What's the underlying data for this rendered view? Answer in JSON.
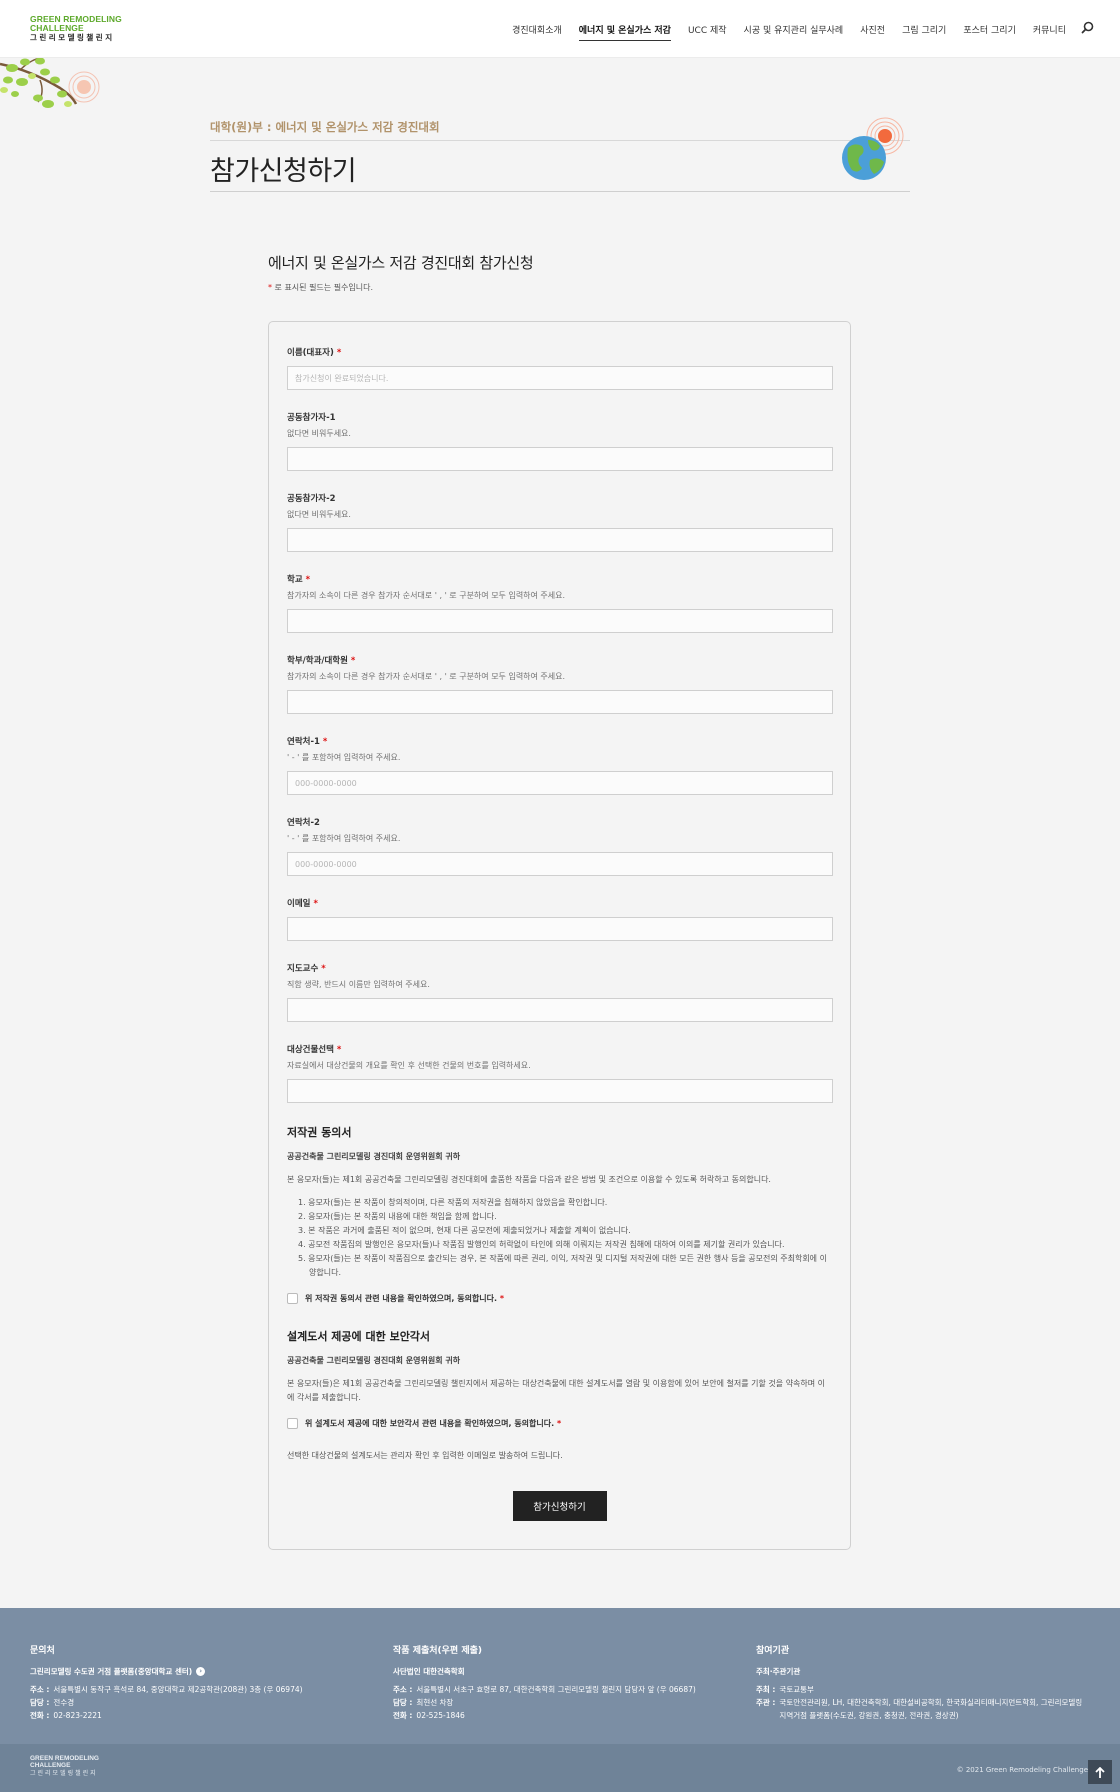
{
  "header": {
    "logo_en_1": "GREEN REMODELING",
    "logo_en_2": "CHALLENGE",
    "logo_ko": "그린리모델링챌린지",
    "nav": [
      {
        "label": "경진대회소개",
        "active": false
      },
      {
        "label": "에너지 및 온실가스 저감",
        "active": true
      },
      {
        "label": "UCC 제작",
        "active": false
      },
      {
        "label": "시공 및 유지관리 실무사례",
        "active": false
      },
      {
        "label": "사진전",
        "active": false
      },
      {
        "label": "그림 그리기",
        "active": false
      },
      {
        "label": "포스터 그리기",
        "active": false
      },
      {
        "label": "커뮤니티",
        "active": false
      }
    ]
  },
  "page": {
    "subtitle": "대학(원)부 : 에너지 및 온실가스 저감 경진대회",
    "title": "참가신청하기"
  },
  "form": {
    "heading": "에너지 및 온실가스 저감 경진대회 참가신청",
    "required_mark": "*",
    "required_note": " 로 표시된 필드는 필수입니다.",
    "fields": [
      {
        "label": "이름(대표자)",
        "required": true,
        "hint": "",
        "placeholder": "참가신청이 완료되었습니다."
      },
      {
        "label": "공동참가자-1",
        "required": false,
        "hint": "없다면 비워두세요.",
        "placeholder": ""
      },
      {
        "label": "공동참가자-2",
        "required": false,
        "hint": "없다면 비워두세요.",
        "placeholder": ""
      },
      {
        "label": "학교",
        "required": true,
        "hint": "참가자의 소속이 다른 경우 참가자 순서대로 ' , ' 로 구분하여 모두 입력하여 주세요.",
        "placeholder": ""
      },
      {
        "label": "학부/학과/대학원",
        "required": true,
        "hint": "참가자의 소속이 다른 경우 참가자 순서대로 ' , ' 로 구분하여 모두 입력하여 주세요.",
        "placeholder": ""
      },
      {
        "label": "연락처-1",
        "required": true,
        "hint": "' - ' 를 포함하여 입력하여 주세요.",
        "placeholder": "000-0000-0000"
      },
      {
        "label": "연락처-2",
        "required": false,
        "hint": "' - ' 를 포함하여 입력하여 주세요.",
        "placeholder": "000-0000-0000"
      },
      {
        "label": "이메일",
        "required": true,
        "hint": "",
        "placeholder": ""
      },
      {
        "label": "지도교수",
        "required": true,
        "hint": "직함 생략, 반드시 이름만 입력하여 주세요.",
        "placeholder": ""
      },
      {
        "label": "대상건물선택",
        "required": true,
        "hint": "자료실에서 대상건물의 개요를 확인 후 선택한 건물의 번호를 입력하세요.",
        "placeholder": ""
      }
    ],
    "copyright": {
      "title": "저작권 동의서",
      "org": "공공건축물 그린리모델링 경진대회 운영위원회 귀하",
      "text": "본 응모자(들)는 제1회 공공건축물 그린리모델링 경진대회에 출품한 작품을 다음과 같은 방법 및 조건으로 이용할 수 있도록 허락하고 동의합니다.",
      "items": [
        "1. 응모자(들)는 본 작품이 창의적이며, 다른 작품의 저작권을 침해하지 않았음을 확인합니다.",
        "2. 응모자(들)는 본 작품의 내용에 대한 책임을 함께 합니다.",
        "3. 본 작품은 과거에 출품된 적이 없으며, 현재 다른 공모전에 제출되었거나 제출할 계획이 없습니다.",
        "4. 공모전 작품집의 발행인은 응모자(들)나 작품집 발행인의 허락없이 타인에 의해 이뤄지는 저작권 침해에 대하여 이의를 제기할 권리가 있습니다.",
        "5. 응모자(들)는 본 작품이 작품집으로 출간되는 경우, 본 작품에 따른 권리, 이익, 저작권 및 디지털 저작권에 대한 모든 권한 행사 등을 공모전의 주최학회에 이양합니다."
      ],
      "check_label": "위 저작권 동의서 관련 내용을 확인하였으며, 동의합니다."
    },
    "security": {
      "title": "설계도서 제공에 대한 보안각서",
      "org": "공공건축물 그린리모델링 경진대회 운영위원회 귀하",
      "text": "본 응모자(들)은 제1회 공공건축물 그린리모델링 챌린지에서 제공하는 대상건축물에 대한 설계도서를 열람 및 이용함에 있어 보안에 철저를 기할 것을 약속하며 이에 각서를 제출합니다.",
      "check_label": "위 설계도서 제공에 대한 보안각서 관련 내용을 확인하였으며, 동의합니다."
    },
    "final_note": "선택한 대상건물의 설계도서는 관리자 확인 후 입력한 이메일로 발송하여 드립니다.",
    "submit_label": "참가신청하기"
  },
  "footer": {
    "col1": {
      "title": "문의처",
      "org": "그린리모델링 수도권 거점 플랫폼(중앙대학교 센터)",
      "address_label": "주소 :",
      "address": "서울특별시 동작구 흑석로 84, 중앙대학교 제2공학관(208관) 3층 (우 06974)",
      "manager_label": "담당 :",
      "manager": "전수경",
      "phone_label": "전화 :",
      "phone": "02-823-2221"
    },
    "col2": {
      "title": "작품 제출처(우편 제출)",
      "org": "사단법인 대한건축학회",
      "address_label": "주소 :",
      "address": "서울특별시 서초구 효령로 87, 대한건축학회 그린리모델링 챌린지 담당자 앞 (우 06687)",
      "manager_label": "담당 :",
      "manager": "최현선 차장",
      "phone_label": "전화 :",
      "phone": "02-525-1846"
    },
    "col3": {
      "title": "참여기관",
      "org": "주최·주관기관",
      "host_label": "주최 :",
      "host": "국토교통부",
      "organizer_label": "주관 :",
      "organizer": "국토안전관리원, LH, 대한건축학회, 대한설비공학회, 한국화실리티매니지먼트학회, 그린리모델링",
      "organizer_2": "지역거점 플랫폼(수도권, 강원권, 충청권, 전라권, 경상권)"
    },
    "logo_en_1": "GREEN REMODELING",
    "logo_en_2": "CHALLENGE",
    "logo_ko": "그린리모델링챌린지",
    "copyright": "© 2021 Green Remodeling Challenge",
    "top_icon": "arrow-up-icon"
  }
}
